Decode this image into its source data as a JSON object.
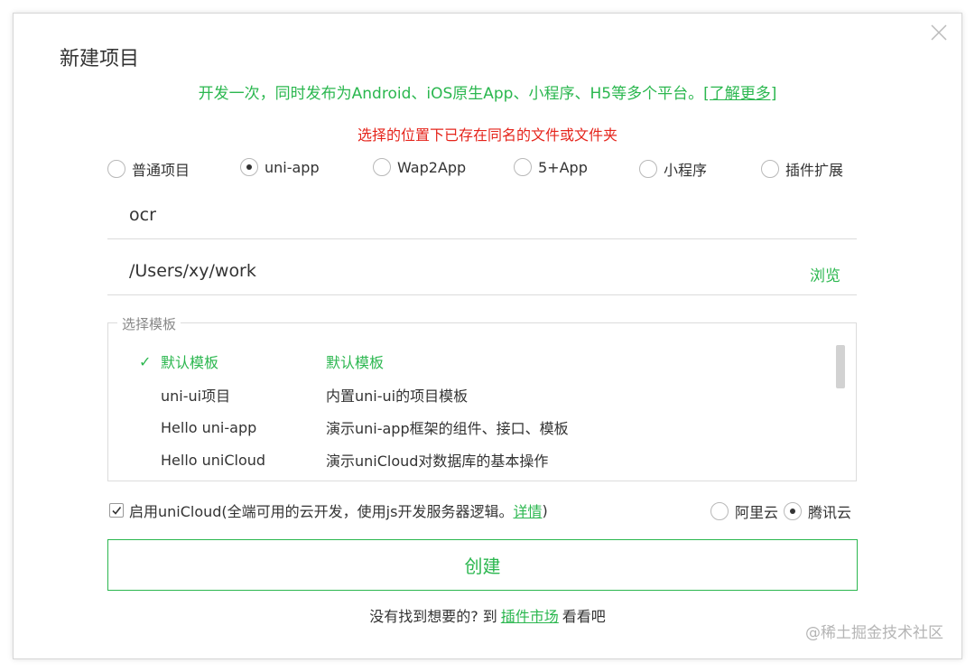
{
  "dialog": {
    "title": "新建项目",
    "tagline": "开发一次，同时发布为Android、iOS原生App、小程序、H5等多个平台。",
    "tagline_link": "[了解更多]",
    "error": "选择的位置下已存在同名的文件或文件夹"
  },
  "project_types": [
    {
      "label": "普通项目",
      "selected": false
    },
    {
      "label": "uni-app",
      "selected": true
    },
    {
      "label": "Wap2App",
      "selected": false
    },
    {
      "label": "5+App",
      "selected": false
    },
    {
      "label": "小程序",
      "selected": false
    },
    {
      "label": "插件扩展",
      "selected": false
    }
  ],
  "name_field": {
    "value": "ocr"
  },
  "path_field": {
    "value": "/Users/xy/work",
    "browse_label": "浏览"
  },
  "templates": {
    "legend": "选择模板",
    "items": [
      {
        "name": "默认模板",
        "description": "默认模板",
        "selected": true
      },
      {
        "name": "uni-ui项目",
        "description": "内置uni-ui的项目模板",
        "selected": false
      },
      {
        "name": "Hello uni-app",
        "description": "演示uni-app框架的组件、接口、模板",
        "selected": false
      },
      {
        "name": "Hello uniCloud",
        "description": "演示uniCloud对数据库的基本操作",
        "selected": false
      }
    ]
  },
  "unicloud": {
    "checked": true,
    "label": "启用uniCloud(全端可用的云开发，使用js开发服务器逻辑。",
    "link": "详情",
    "suffix": ")",
    "providers": [
      {
        "label": "阿里云",
        "selected": false
      },
      {
        "label": "腾讯云",
        "selected": true
      }
    ]
  },
  "create_button": "创建",
  "footer": {
    "prefix": "没有找到想要的? 到",
    "link": "插件市场",
    "suffix": "看看吧"
  },
  "watermark": "@稀土掘金技术社区",
  "colors": {
    "accent": "#2bb74f",
    "error": "#e5251c"
  }
}
